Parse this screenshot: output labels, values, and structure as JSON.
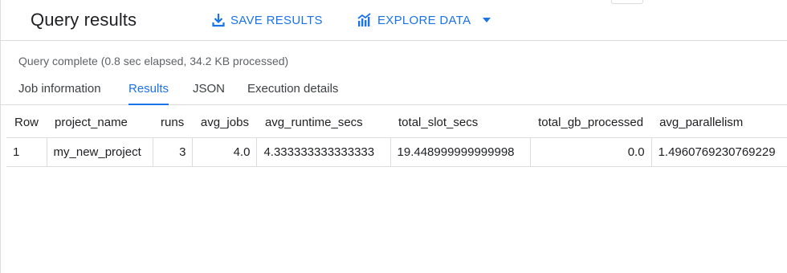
{
  "header": {
    "title": "Query results",
    "save_label": "SAVE RESULTS",
    "explore_label": "EXPLORE DATA"
  },
  "status": "Query complete (0.8 sec elapsed, 34.2 KB processed)",
  "tabs": [
    {
      "label": "Job information",
      "active": false
    },
    {
      "label": "Results",
      "active": true
    },
    {
      "label": "JSON",
      "active": false
    },
    {
      "label": "Execution details",
      "active": false
    }
  ],
  "table": {
    "columns": [
      "Row",
      "project_name",
      "runs",
      "avg_jobs",
      "avg_runtime_secs",
      "total_slot_secs",
      "total_gb_processed",
      "avg_parallelism"
    ],
    "rows": [
      [
        "1",
        "my_new_project",
        "3",
        "4.0",
        "4.333333333333333",
        "19.448999999999998",
        "0.0",
        "1.4960769230769229"
      ]
    ]
  },
  "colors": {
    "accent": "#1a73e8",
    "border": "#dadce0",
    "muted_text": "#5f6368"
  },
  "icons": {
    "save": "download-icon",
    "explore": "chart-icon",
    "dropdown": "caret-down-icon"
  }
}
